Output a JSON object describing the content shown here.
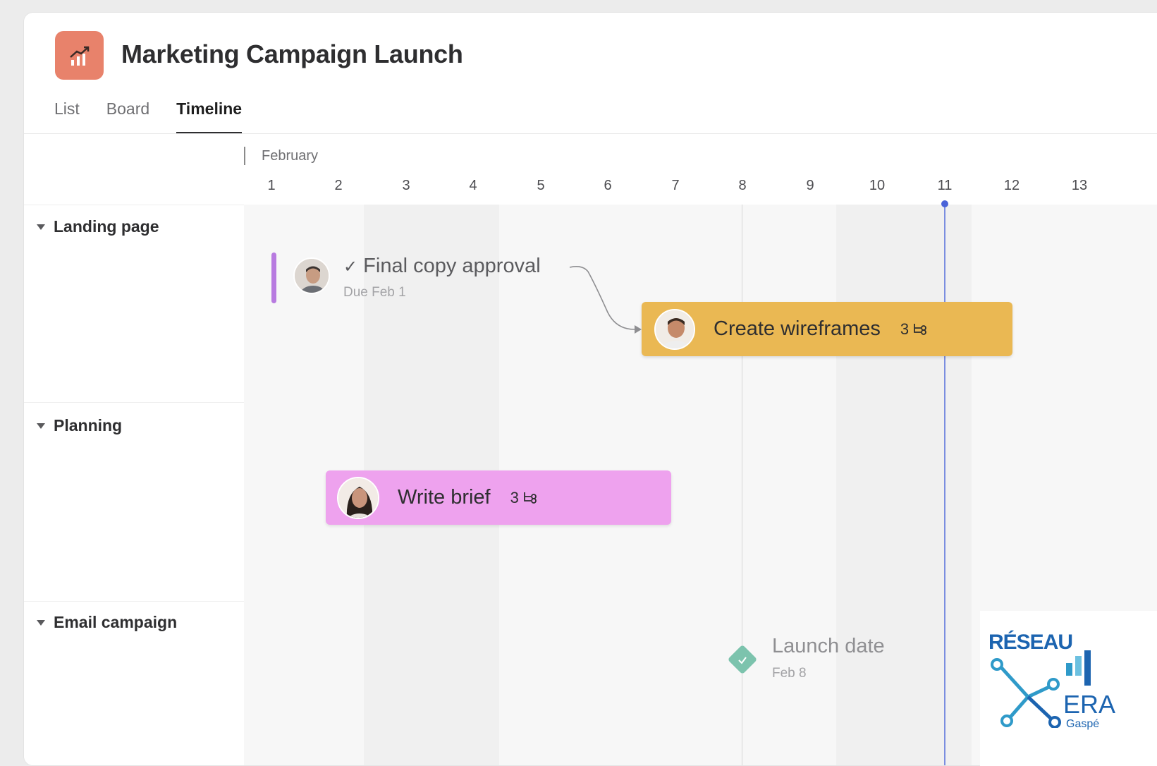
{
  "project": {
    "title": "Marketing Campaign Launch",
    "icon": "trend-chart-icon",
    "icon_color": "#e8826b"
  },
  "tabs": [
    {
      "label": "List",
      "active": false
    },
    {
      "label": "Board",
      "active": false
    },
    {
      "label": "Timeline",
      "active": true
    }
  ],
  "timeline": {
    "month": "February",
    "days": [
      "1",
      "2",
      "3",
      "4",
      "5",
      "6",
      "7",
      "8",
      "9",
      "10",
      "11",
      "12",
      "13"
    ],
    "today": "11"
  },
  "sections": [
    {
      "label": "Landing page"
    },
    {
      "label": "Planning"
    },
    {
      "label": "Email campaign"
    }
  ],
  "tasks": {
    "final_copy": {
      "check": "✓",
      "title": "Final copy approval",
      "due": "Due Feb 1"
    },
    "wireframes": {
      "title": "Create wireframes",
      "subtasks": "3",
      "color": "#eab853"
    },
    "write_brief": {
      "title": "Write brief",
      "subtasks": "3",
      "color": "#eea2ee"
    },
    "launch": {
      "title": "Launch date",
      "date": "Feb 8",
      "color": "#7cc3ad"
    }
  },
  "logo": {
    "word": "RÉSEAU",
    "name": "ERA",
    "sub": "Gaspé"
  }
}
